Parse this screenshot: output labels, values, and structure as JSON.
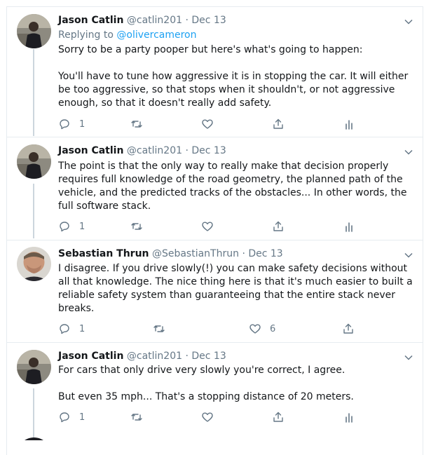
{
  "tweets": [
    {
      "name": "Jason Catlin",
      "handle": "@catlin201",
      "separator": "·",
      "date": "Dec 13",
      "reply_prefix": "Replying to",
      "reply_to": "@olivercameron",
      "paragraphs": [
        "Sorry to be a party pooper but here's what's going to happen:",
        "You'll have to tune how aggressive it is in stopping the car.  It will either be too aggressive, so that stops when it shouldn't, or not aggressive enough, so that it doesn't really add safety."
      ],
      "replies": "1",
      "retweets": "",
      "likes": ""
    },
    {
      "name": "Jason Catlin",
      "handle": "@catlin201",
      "separator": "·",
      "date": "Dec 13",
      "paragraphs": [
        "The point is that the only way to really make that decision properly requires full knowledge of the road geometry, the planned path of the vehicle, and the predicted tracks of the obstacles... In other words, the full software stack."
      ],
      "replies": "1",
      "retweets": "",
      "likes": ""
    },
    {
      "name": "Sebastian Thrun",
      "handle": "@SebastianThrun",
      "separator": "·",
      "date": "Dec 13",
      "paragraphs": [
        "I  disagree. If you drive slowly(!) you can make safety decisions without all that knowledge. The nice thing here is that it's much easier to built a reliable safety system than guaranteeing that the entire stack never breaks."
      ],
      "replies": "1",
      "retweets": "",
      "likes": "6"
    },
    {
      "name": "Jason Catlin",
      "handle": "@catlin201",
      "separator": "·",
      "date": "Dec 13",
      "paragraphs": [
        "For cars that only drive very slowly you're correct, I agree.",
        "But even 35 mph... That's a stopping distance of 20 meters."
      ],
      "replies": "1",
      "retweets": "",
      "likes": ""
    }
  ],
  "icons": {
    "reply": "reply-icon",
    "retweet": "retweet-icon",
    "like": "heart-icon",
    "share": "share-icon",
    "analytics": "analytics-icon",
    "more": "chevron-down-icon"
  },
  "colors": {
    "text": "#14171a",
    "secondary": "#657786",
    "link": "#1da1f2",
    "divider": "#e6ecf0",
    "thread": "#ccd6dd"
  }
}
